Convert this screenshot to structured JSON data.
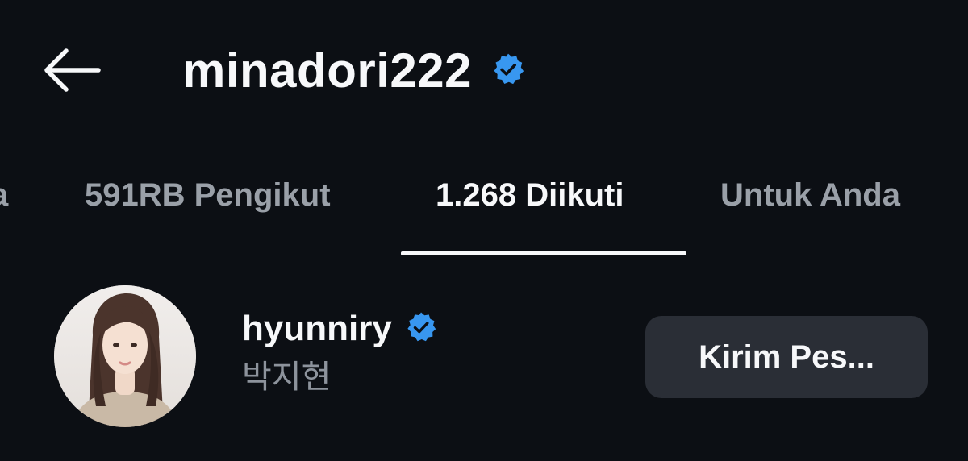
{
  "header": {
    "back_icon": "arrow-left-icon",
    "title": "minadori222",
    "verified_icon": "verified-badge-icon"
  },
  "tabs": [
    {
      "label": "a",
      "active": false
    },
    {
      "label": "591RB Pengikut",
      "active": false
    },
    {
      "label": "1.268 Diikuti",
      "active": true
    },
    {
      "label": "Untuk Anda",
      "active": false
    }
  ],
  "list": {
    "items": [
      {
        "username": "hyunniry",
        "full_name": "박지현",
        "verified": true,
        "button_label": "Kirim Pes..."
      }
    ]
  },
  "colors": {
    "background": "#0c0f14",
    "verified_blue": "#3897f0",
    "button_bg": "#2a2e36",
    "secondary_text": "#8d939c",
    "tab_inactive": "#9aa0a8",
    "divider": "#262a31"
  }
}
